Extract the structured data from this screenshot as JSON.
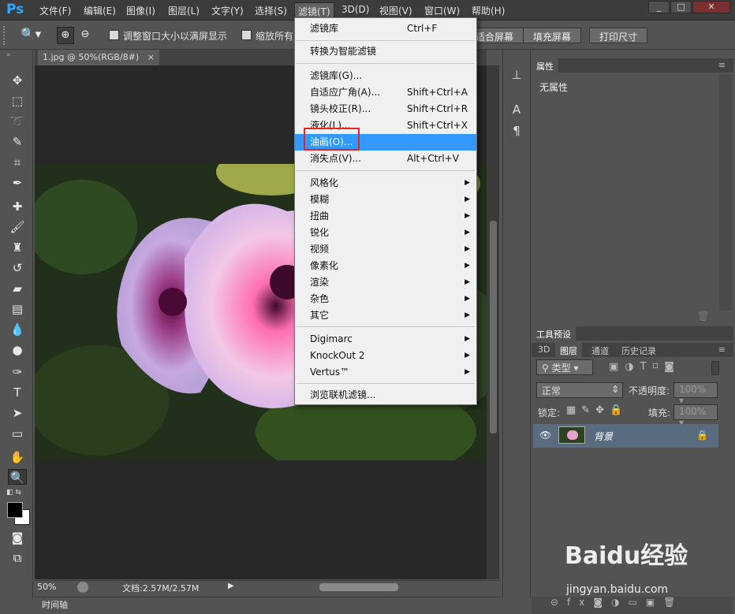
{
  "app": {
    "logo": "Ps"
  },
  "menubar": {
    "items": [
      "文件(F)",
      "编辑(E)",
      "图像(I)",
      "图层(L)",
      "文字(Y)",
      "选择(S)",
      "滤镜(T)",
      "3D(D)",
      "视图(V)",
      "窗口(W)",
      "帮助(H)"
    ]
  },
  "window_controls": {
    "minimize": "_",
    "maximize": "□",
    "close": "✕"
  },
  "options_bar": {
    "resize_label": "调整窗口大小以满屏显示",
    "zoom_all_label": "缩放所有",
    "fit_screen": "适合屏幕",
    "fill_screen": "填充屏幕",
    "print_size": "打印尺寸"
  },
  "document": {
    "tab_title": "1.jpg @ 50%(RGB/8#)",
    "tab_close": "×"
  },
  "status_bar": {
    "zoom": "50%",
    "doc_size": "文档:2.57M/2.57M"
  },
  "timeline": {
    "label": "时间轴"
  },
  "filter_menu": {
    "items": [
      {
        "label": "滤镜库",
        "shortcut": "Ctrl+F"
      },
      {
        "label": "转换为智能滤镜"
      },
      {
        "label": "滤镜库(G)..."
      },
      {
        "label": "自适应广角(A)...",
        "shortcut": "Shift+Ctrl+A"
      },
      {
        "label": "镜头校正(R)...",
        "shortcut": "Shift+Ctrl+R"
      },
      {
        "label": "液化(L)...",
        "shortcut": "Shift+Ctrl+X"
      },
      {
        "label": "油画(O)...",
        "highlighted": true
      },
      {
        "label": "消失点(V)...",
        "shortcut": "Alt+Ctrl+V"
      },
      {
        "label": "风格化",
        "submenu": true
      },
      {
        "label": "模糊",
        "submenu": true
      },
      {
        "label": "扭曲",
        "submenu": true
      },
      {
        "label": "锐化",
        "submenu": true
      },
      {
        "label": "视频",
        "submenu": true
      },
      {
        "label": "像素化",
        "submenu": true
      },
      {
        "label": "渲染",
        "submenu": true
      },
      {
        "label": "杂色",
        "submenu": true
      },
      {
        "label": "其它",
        "submenu": true
      },
      {
        "label": "Digimarc",
        "submenu": true
      },
      {
        "label": "KnockOut 2",
        "submenu": true
      },
      {
        "label": "Vertus™",
        "submenu": true
      },
      {
        "label": "浏览联机滤镜..."
      }
    ]
  },
  "properties_panel": {
    "tab": "属性",
    "content": "无属性"
  },
  "tool_presets_panel": {
    "tab": "工具预设"
  },
  "layers_panel": {
    "tabs": [
      "3D",
      "图层",
      "通道",
      "历史记录"
    ],
    "filter_kind": "类型",
    "blend_mode": "正常",
    "opacity_label": "不透明度:",
    "opacity_value": "100%",
    "lock_label": "锁定:",
    "fill_label": "填充:",
    "fill_value": "100%",
    "layer_name": "背景"
  },
  "watermark": {
    "brand": "Baidu经验",
    "url": "jingyan.baidu.com"
  },
  "colors": {
    "menu_highlight": "#3399ff",
    "callout_border": "#e22222",
    "ps_blue": "#31a8ff"
  }
}
